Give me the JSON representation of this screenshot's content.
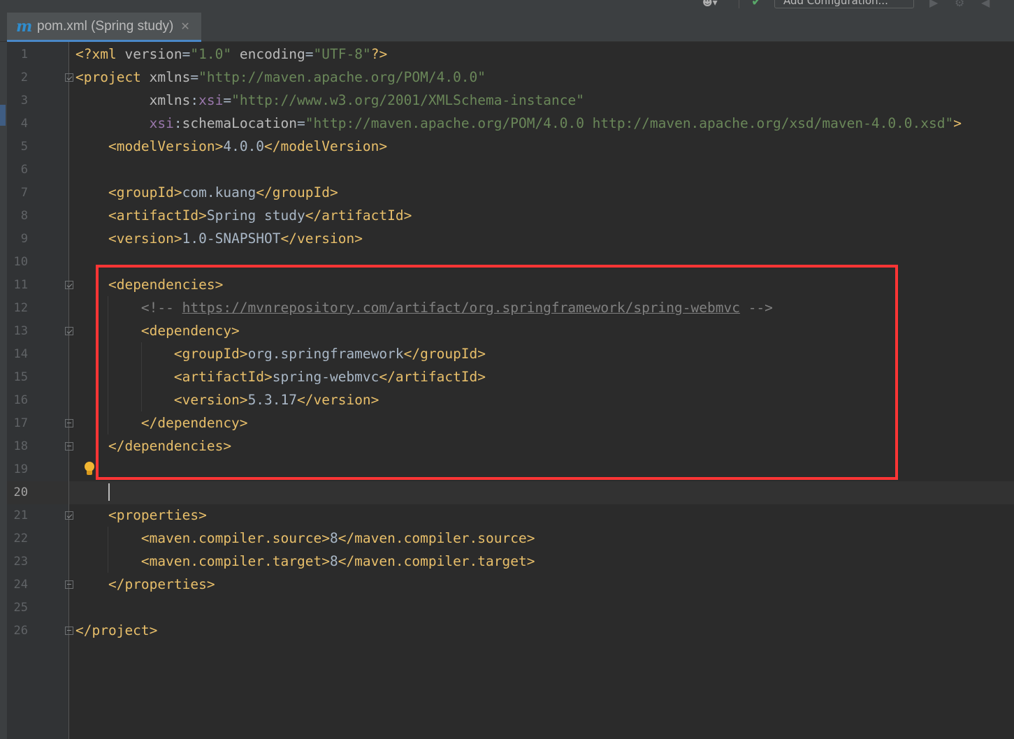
{
  "toolbar": {
    "run_config_label": "Add Configuration..."
  },
  "tab": {
    "label": "pom.xml (Spring study)",
    "close_glyph": "✕",
    "icon": "maven-icon",
    "icon_glyph": "m"
  },
  "editor": {
    "caret_line": 20,
    "lines": [
      {
        "n": "1",
        "tokens": [
          [
            "decl",
            "<?xml "
          ],
          [
            "attr",
            "version"
          ],
          [
            "txt",
            "="
          ],
          [
            "str",
            "\"1.0\""
          ],
          [
            "txt",
            " "
          ],
          [
            "attr",
            "encoding"
          ],
          [
            "txt",
            "="
          ],
          [
            "str",
            "\"UTF-8\""
          ],
          [
            "decl",
            "?>"
          ]
        ]
      },
      {
        "n": "2",
        "tokens": [
          [
            "tag",
            "<project "
          ],
          [
            "attr",
            "xmlns"
          ],
          [
            "txt",
            "="
          ],
          [
            "str",
            "\"http://maven.apache.org/POM/4.0.0\""
          ]
        ]
      },
      {
        "n": "3",
        "tokens": [
          [
            "txt",
            "         "
          ],
          [
            "attr",
            "xmlns"
          ],
          [
            "txt",
            ":"
          ],
          [
            "ns",
            "xsi"
          ],
          [
            "txt",
            "="
          ],
          [
            "str",
            "\"http://www.w3.org/2001/XMLSchema-instance\""
          ]
        ]
      },
      {
        "n": "4",
        "tokens": [
          [
            "txt",
            "         "
          ],
          [
            "ns",
            "xsi"
          ],
          [
            "txt",
            ":"
          ],
          [
            "attr",
            "schemaLocation"
          ],
          [
            "txt",
            "="
          ],
          [
            "str",
            "\"http://maven.apache.org/POM/4.0.0 http://maven.apache.org/xsd/maven-4.0.0.xsd\""
          ],
          [
            "tag",
            ">"
          ]
        ]
      },
      {
        "n": "5",
        "tokens": [
          [
            "txt",
            "    "
          ],
          [
            "tag",
            "<modelVersion>"
          ],
          [
            "txt",
            "4.0.0"
          ],
          [
            "tag",
            "</modelVersion>"
          ]
        ]
      },
      {
        "n": "6",
        "tokens": []
      },
      {
        "n": "7",
        "tokens": [
          [
            "txt",
            "    "
          ],
          [
            "tag",
            "<groupId>"
          ],
          [
            "txt",
            "com.kuang"
          ],
          [
            "tag",
            "</groupId>"
          ]
        ]
      },
      {
        "n": "8",
        "tokens": [
          [
            "txt",
            "    "
          ],
          [
            "tag",
            "<artifactId>"
          ],
          [
            "txt",
            "Spring study"
          ],
          [
            "tag",
            "</artifactId>"
          ]
        ]
      },
      {
        "n": "9",
        "tokens": [
          [
            "txt",
            "    "
          ],
          [
            "tag",
            "<version>"
          ],
          [
            "txt",
            "1.0-SNAPSHOT"
          ],
          [
            "tag",
            "</version>"
          ]
        ]
      },
      {
        "n": "10",
        "tokens": []
      },
      {
        "n": "11",
        "tokens": [
          [
            "txt",
            "    "
          ],
          [
            "tag",
            "<dependencies>"
          ]
        ]
      },
      {
        "n": "12",
        "tokens": [
          [
            "txt",
            "        "
          ],
          [
            "cmt",
            "<!-- "
          ],
          [
            "url",
            "https://mvnrepository.com/artifact/org.springframework/spring-webmvc"
          ],
          [
            "cmt",
            " -->"
          ]
        ]
      },
      {
        "n": "13",
        "tokens": [
          [
            "txt",
            "        "
          ],
          [
            "tag",
            "<dependency>"
          ]
        ]
      },
      {
        "n": "14",
        "tokens": [
          [
            "txt",
            "            "
          ],
          [
            "tag",
            "<groupId>"
          ],
          [
            "txt",
            "org.springframework"
          ],
          [
            "tag",
            "</groupId>"
          ]
        ]
      },
      {
        "n": "15",
        "tokens": [
          [
            "txt",
            "            "
          ],
          [
            "tag",
            "<artifactId>"
          ],
          [
            "txt",
            "spring-webmvc"
          ],
          [
            "tag",
            "</artifactId>"
          ]
        ]
      },
      {
        "n": "16",
        "tokens": [
          [
            "txt",
            "            "
          ],
          [
            "tag",
            "<version>"
          ],
          [
            "txt",
            "5.3.17"
          ],
          [
            "tag",
            "</version>"
          ]
        ]
      },
      {
        "n": "17",
        "tokens": [
          [
            "txt",
            "        "
          ],
          [
            "tag",
            "</dependency>"
          ]
        ]
      },
      {
        "n": "18",
        "tokens": [
          [
            "txt",
            "    "
          ],
          [
            "tag",
            "</dependencies>"
          ]
        ]
      },
      {
        "n": "19",
        "tokens": []
      },
      {
        "n": "20",
        "tokens": []
      },
      {
        "n": "21",
        "tokens": [
          [
            "txt",
            "    "
          ],
          [
            "tag",
            "<properties>"
          ]
        ]
      },
      {
        "n": "22",
        "tokens": [
          [
            "txt",
            "        "
          ],
          [
            "tag",
            "<maven.compiler.source>"
          ],
          [
            "txt",
            "8"
          ],
          [
            "tag",
            "</maven.compiler.source>"
          ]
        ]
      },
      {
        "n": "23",
        "tokens": [
          [
            "txt",
            "        "
          ],
          [
            "tag",
            "<maven.compiler.target>"
          ],
          [
            "txt",
            "8"
          ],
          [
            "tag",
            "</maven.compiler.target>"
          ]
        ]
      },
      {
        "n": "24",
        "tokens": [
          [
            "txt",
            "    "
          ],
          [
            "tag",
            "</properties>"
          ]
        ]
      },
      {
        "n": "25",
        "tokens": []
      },
      {
        "n": "26",
        "tokens": [
          [
            "tag",
            "</project>"
          ]
        ]
      }
    ],
    "fold_markers": [
      {
        "line": 2,
        "kind": "open"
      },
      {
        "line": 11,
        "kind": "open"
      },
      {
        "line": 13,
        "kind": "open"
      },
      {
        "line": 17,
        "kind": "close"
      },
      {
        "line": 18,
        "kind": "close"
      },
      {
        "line": 21,
        "kind": "open"
      },
      {
        "line": 24,
        "kind": "close"
      },
      {
        "line": 26,
        "kind": "close"
      }
    ],
    "intention_bulb_line": 19,
    "annotation": {
      "type": "highlight-box",
      "color": "#fe3535",
      "from_line": 11,
      "to_line": 19
    }
  },
  "colors": {
    "background": "#2b2b2b",
    "tag": "#e8bf6a",
    "string": "#6a8759",
    "namespace": "#9876aa",
    "comment": "#808080",
    "text": "#a9b7c6"
  }
}
